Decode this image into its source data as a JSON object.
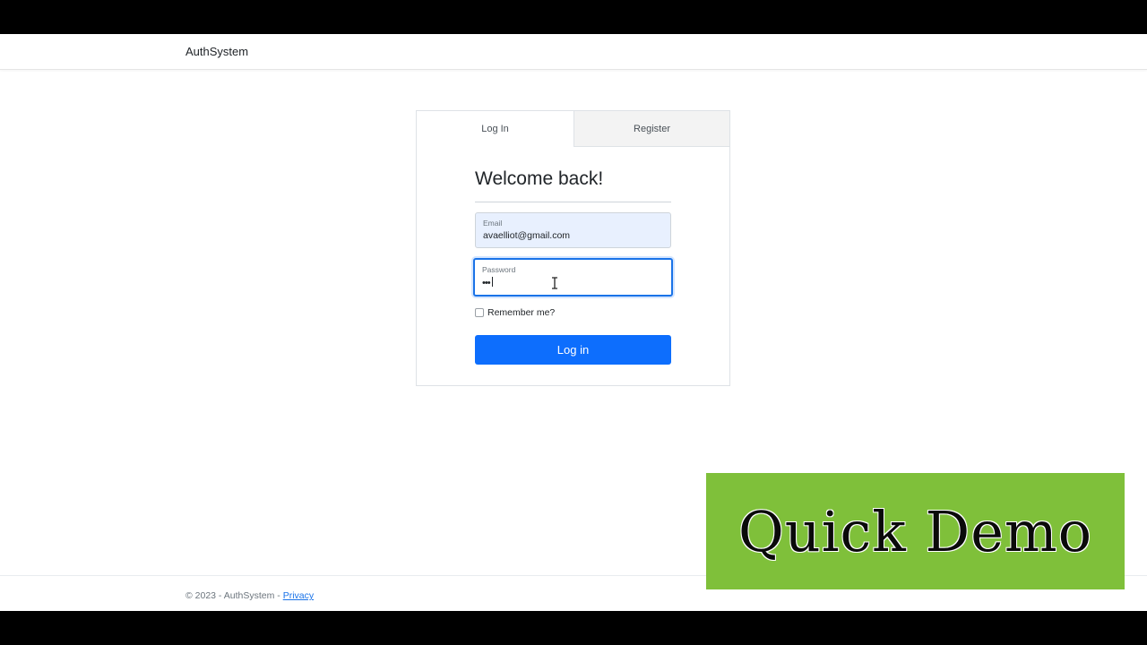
{
  "navbar": {
    "brand": "AuthSystem"
  },
  "tabs": [
    {
      "label": "Log In",
      "active": true
    },
    {
      "label": "Register",
      "active": false
    }
  ],
  "form": {
    "heading": "Welcome back!",
    "email": {
      "label": "Email",
      "value": "avaelliot@gmail.com"
    },
    "password": {
      "label": "Password",
      "value": "•••"
    },
    "remember_label": "Remember me?",
    "remember_checked": false,
    "submit_label": "Log in"
  },
  "footer": {
    "text": "© 2023 - AuthSystem - ",
    "privacy_label": "Privacy"
  },
  "overlay": {
    "banner_text": "Quick Demo"
  },
  "colors": {
    "primary": "#0d6efd",
    "focus_border": "#1a73e8",
    "autofill_bg": "#e8f0fe",
    "banner_bg": "#7fc03a"
  }
}
